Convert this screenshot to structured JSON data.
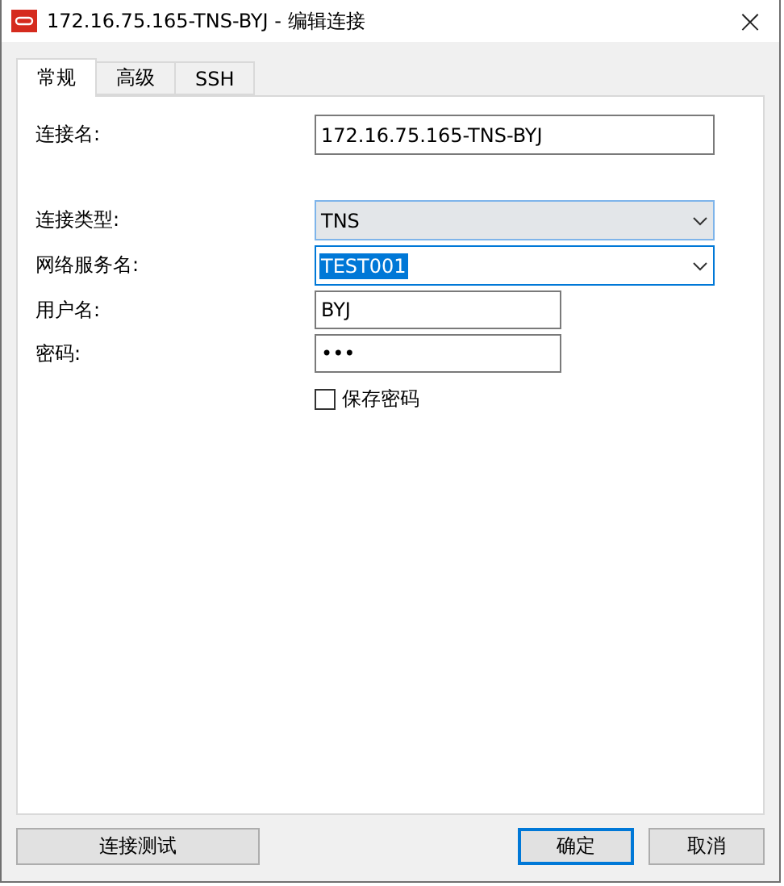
{
  "window": {
    "title": "172.16.75.165-TNS-BYJ - 编辑连接",
    "close": "×"
  },
  "tabs": [
    {
      "label": "常规",
      "selected": true
    },
    {
      "label": "高级",
      "selected": false
    },
    {
      "label": "SSH",
      "selected": false
    }
  ],
  "fields": [
    {
      "kind": "text",
      "label": "连接名:",
      "value": "172.16.75.165-TNS-BYJ",
      "wide": true
    },
    {
      "kind": "select",
      "label": "连接类型:",
      "value": "TNS",
      "focused": false
    },
    {
      "kind": "combo",
      "label": "网络服务名:",
      "value": "TEST001",
      "focused": true
    },
    {
      "kind": "text",
      "label": "用户名:",
      "value": "BYJ",
      "wide": false
    },
    {
      "kind": "password",
      "label": "密码:",
      "value": "•••",
      "wide": false
    }
  ],
  "save_password": {
    "label": "保存密码",
    "checked": false
  },
  "buttons": [
    {
      "label": "连接测试",
      "kind": "test",
      "default": false
    },
    {
      "label": "确定",
      "kind": "ok",
      "default": true
    },
    {
      "label": "取消",
      "kind": "cancel",
      "default": false
    }
  ]
}
